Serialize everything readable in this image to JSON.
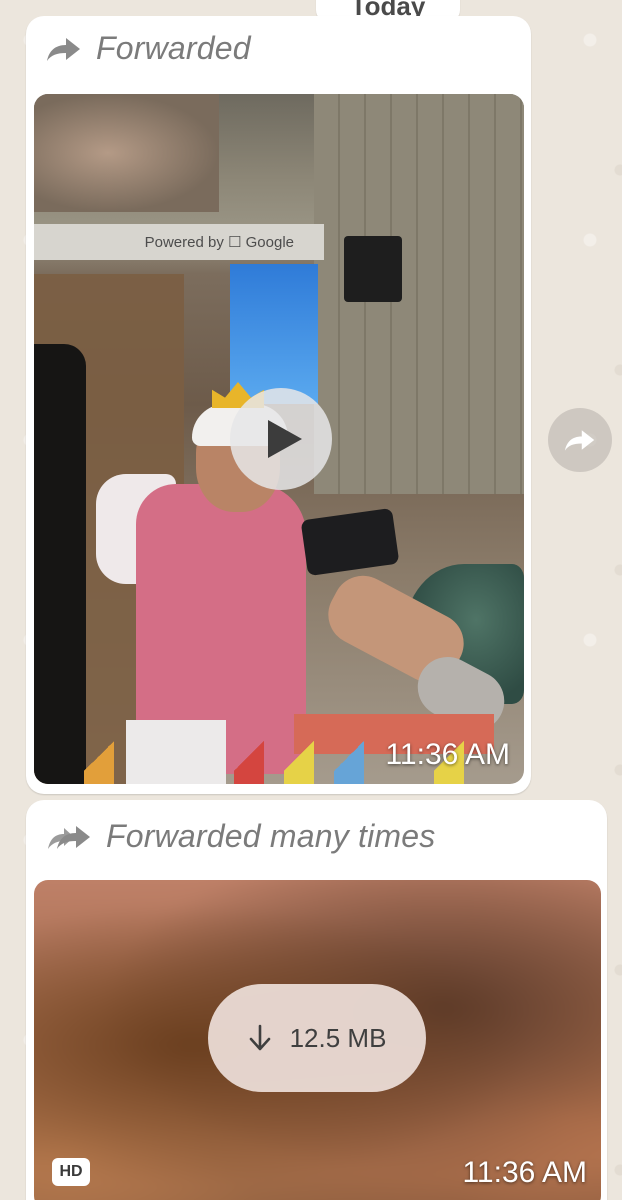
{
  "date_separator": {
    "label": "Today"
  },
  "messages": [
    {
      "forward_label": "Forwarded",
      "forward_icon": "forward-arrow-icon",
      "media": {
        "type": "video",
        "overlay_text": "Powered by ☐ Google",
        "play_icon": "play-icon",
        "time": "11:36 AM"
      }
    },
    {
      "forward_label": "Forwarded many times",
      "forward_icon": "double-forward-arrow-icon",
      "media": {
        "type": "video-undownloaded",
        "download_icon": "download-arrow-icon",
        "download_size": "12.5 MB",
        "hd_badge": "HD",
        "time": "11:36 AM"
      }
    }
  ],
  "side_actions": {
    "share_icon": "share-forward-icon"
  },
  "colors": {
    "chat_background": "#ece6dd",
    "bubble": "#ffffff",
    "forward_text": "#7b7b7b"
  }
}
